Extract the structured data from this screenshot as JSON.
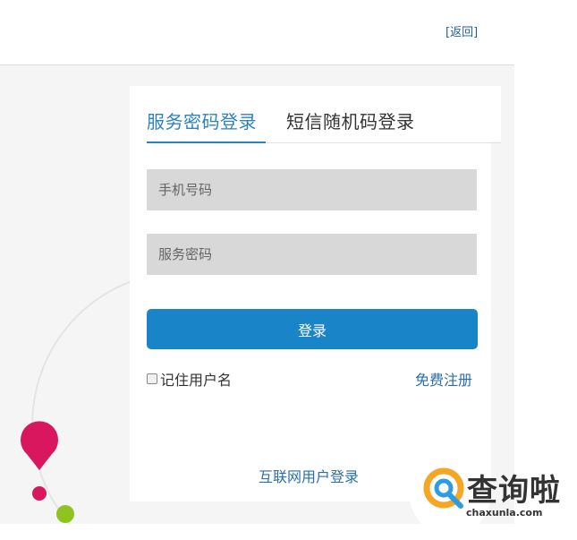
{
  "header": {
    "back_label": "[返回]"
  },
  "tabs": [
    {
      "label": "服务密码登录",
      "active": true
    },
    {
      "label": "短信随机码登录",
      "active": false
    }
  ],
  "form": {
    "phone_placeholder": "手机号码",
    "password_placeholder": "服务密码",
    "login_label": "登录",
    "remember_label": "记住用户名",
    "remember_checked": false,
    "register_label": "免费注册",
    "internet_login_label": "互联网用户登录"
  },
  "watermark": {
    "brand": "查询啦",
    "domain": "chaxunla.com"
  },
  "colors": {
    "accent": "#2b82bd",
    "button": "#1a84c8",
    "link": "#2b6fa8",
    "input_bg": "#d8d8d8",
    "pin_pink": "#d9175f",
    "pin_green": "#8fc31f"
  }
}
